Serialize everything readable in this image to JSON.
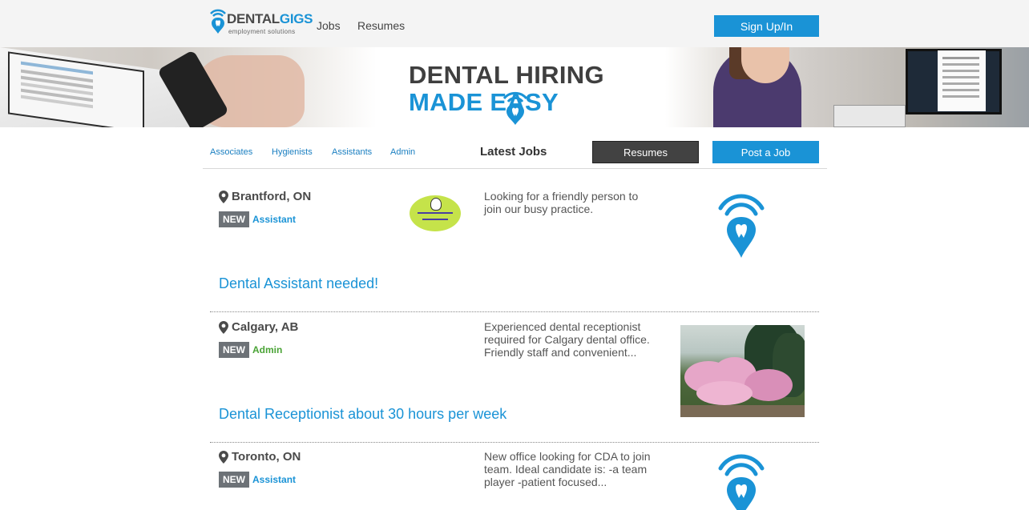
{
  "header": {
    "logo_word_dark": "DENTAL",
    "logo_word_blue": "GIGS",
    "logo_sub": "employment solutions",
    "nav": {
      "jobs": "Jobs",
      "resumes": "Resumes"
    },
    "signup_label": "Sign Up/In"
  },
  "banner": {
    "line1": "DENTAL HIRING",
    "line2": "MADE   EASY"
  },
  "subnav": {
    "links": [
      "Associates",
      "Hygienists",
      "Assistants",
      "Admin"
    ],
    "heading": "Latest Jobs",
    "resumes_label": "Resumes",
    "post_label": "Post a Job"
  },
  "jobs": [
    {
      "location": "Brantford, ON",
      "tag": "NEW",
      "category": "Assistant",
      "description": "Looking for a friendly person to join our busy practice.",
      "title": "Dental Assistant needed!"
    },
    {
      "location": "Calgary, AB",
      "tag": "NEW",
      "category": "Admin",
      "description": "Experienced dental receptionist required for Calgary dental office. Friendly staff and convenient...",
      "title": "Dental Receptionist about 30 hours per week"
    },
    {
      "location": "Toronto, ON",
      "tag": "NEW",
      "category": "Assistant",
      "description": "New office looking for CDA to join team. Ideal candidate is: -a team player -patient focused..."
    }
  ],
  "colors": {
    "brand_blue": "#1a93d6",
    "dark_button": "#424242",
    "tag_gray": "#6d7277",
    "admin_green": "#4aa336"
  },
  "icons": [
    "tooth-pin-logo-icon",
    "map-pin-icon",
    "signal-tooth-icon"
  ]
}
